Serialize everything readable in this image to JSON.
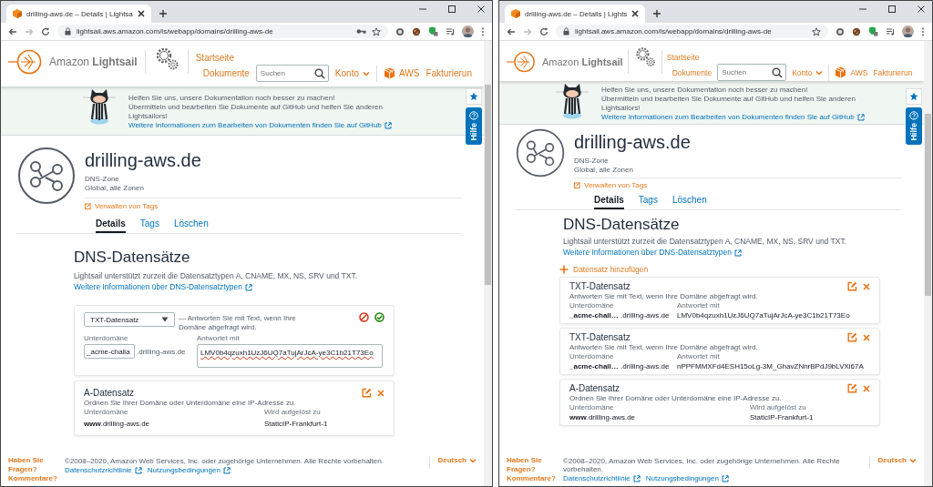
{
  "windows": [
    {
      "tab_title": "drilling-aws.de – Details | Lightsa",
      "url": "lightsail.aws.amazon.com/ls/webapp/domains/drilling-aws-de",
      "password_icon": true,
      "header": {
        "logo": "Amazon **Lightsail**",
        "home": "Startseite",
        "docs": "Dokumente",
        "search_placeholder": "Suchen",
        "account": "Konto",
        "aws": "AWS",
        "billing": "Fakturierun"
      },
      "banner": {
        "lines": [
          "Helfen Sie uns, unsere Dokumentation noch besser zu machen!",
          "Übermitteln und bearbeiten Sie Dokumente auf GitHub und helfen Sie anderen Lightsailors!"
        ],
        "link": "Weitere Informationen zum Bearbeiten von Dokumenten finden Sie auf GitHub"
      },
      "help_tab": "Hilfe",
      "zone": {
        "name": "drilling-aws.de",
        "type": "DNS-Zone",
        "region": "Global, alle Zonen",
        "tags_link": "Verwalten von Tags"
      },
      "tabs": [
        {
          "label": "Details",
          "selected": true
        },
        {
          "label": "Tags",
          "selected": false
        },
        {
          "label": "Löschen",
          "selected": false
        }
      ],
      "section": {
        "title": "DNS-Datensätze",
        "text": "Lightsail unterstützt zurzeit die Datensatztypen A, CNAME, MX, NS, SRV und TXT.",
        "link": "Weitere Informationen über DNS-Datensatztypen"
      },
      "records": [
        {
          "kind": "edit",
          "record_type": "TXT-Datensatz",
          "hint": "— Antworten Sie mit Text, wenn Ihre Domäne abgefragt wird.",
          "subdomain_label": "Unterdomäne",
          "subdomain_value": "_acme-challa",
          "domain_suffix": ".drilling-aws.de",
          "target_label": "Antwortet mit",
          "target_value": "LMV0b4qzuxh1UzJ6UQ7aTujArJcA-ye3C1b21T73Eo"
        },
        {
          "kind": "a",
          "title": "A-Datensatz",
          "description": "Ordnen Sie Ihrer Domäne oder Unterdomäne eine IP-Adresse zu.",
          "subdomain_label": "Unterdomäne",
          "subdomain": "**www**.drilling-aws.de",
          "target_label": "Wird aufgelöst zu",
          "target": "StaticIP-Frankfurt-1"
        }
      ],
      "footer": {
        "feedback": "Haben Sie Fragen? Kommentare?",
        "copyright": "©2008–2020, Amazon Web Services, Inc. oder zugehörige Unternehmen. Alle Rechte vorbehalten.",
        "links": [
          "Datenschutzrichtlinie",
          "Nutzungsbedingungen"
        ],
        "language": "Deutsch"
      }
    },
    {
      "tab_title": "drilling-aws.de – Details | Lights",
      "url": "lightsail.aws.amazon.com/ls/webapp/domains/drilling-aws-de",
      "password_icon": false,
      "header": {
        "logo": "Amazon **Lightsail**",
        "home": "Startseite",
        "docs": "Dokumente",
        "search_placeholder": "Suchen",
        "account": "Konto",
        "aws": "AWS",
        "billing": "Fakturierun"
      },
      "banner": {
        "lines": [
          "Helfen Sie uns, unsere Dokumentation noch besser zu machen!",
          "Übermitteln und bearbeiten Sie Dokumente auf GitHub und helfen Sie anderen Lightsailors!"
        ],
        "link": "Weitere Informationen zum Bearbeiten von Dokumenten finden Sie auf GitHub"
      },
      "help_tab": "Hilfe",
      "zone": {
        "name": "drilling-aws.de",
        "type": "DNS-Zone",
        "region": "Global, alle Zonen",
        "tags_link": "Verwalten von Tags"
      },
      "tabs": [
        {
          "label": "Details",
          "selected": true
        },
        {
          "label": "Tags",
          "selected": false
        },
        {
          "label": "Löschen",
          "selected": false
        }
      ],
      "section": {
        "title": "DNS-Datensätze",
        "text": "Lightsail unterstützt zurzeit die Datensatztypen A, CNAME, MX, NS, SRV und TXT.",
        "link": "Weitere Informationen über DNS-Datensatztypen"
      },
      "add_record": "Datensatz hinzufügen",
      "records": [
        {
          "kind": "txt",
          "title": "TXT-Datensatz",
          "description": "Antworten Sie mit Text, wenn Ihre Domäne abgefragt wird.",
          "subdomain_label": "Unterdomäne",
          "subdomain": "**_acme-chall…** .drilling-aws.de",
          "target_label": "Antwortet mit",
          "target": "LMV0b4qzuxh1UzJ6UQ7aTujArJcA-ye3C1b21T73Eo"
        },
        {
          "kind": "txt",
          "title": "TXT-Datensatz",
          "description": "Antworten Sie mit Text, wenn Ihre Domäne abgefragt wird.",
          "subdomain_label": "Unterdomäne",
          "subdomain": "**_acme-chall…** .drilling-aws.de",
          "target_label": "Antwortet mit",
          "target": "nPPFMMXFd4ESH15oLg-3M_GhavZNnrBPdJ9bLVXi67A"
        },
        {
          "kind": "a",
          "title": "A-Datensatz",
          "description": "Ordnen Sie Ihrer Domäne oder Unterdomäne eine IP-Adresse zu.",
          "subdomain_label": "Unterdomäne",
          "subdomain": "**www**.drilling-aws.de",
          "target_label": "Wird aufgelöst zu",
          "target": "StaticIP-Frankfurt-1"
        }
      ],
      "footer": {
        "feedback": "Haben Sie Fragen? Kommentare?",
        "copyright": "©2008–2020, Amazon Web Services, Inc. oder zugehörige Unternehmen. Alle Rechte vorbehalten.",
        "links": [
          "Datenschutzrichtlinie",
          "Nutzungsbedingungen"
        ],
        "language": "Deutsch"
      }
    }
  ]
}
